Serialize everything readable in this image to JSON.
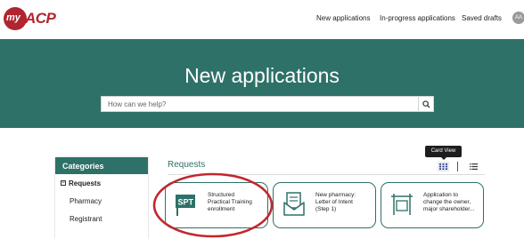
{
  "logo": {
    "prefix": "my",
    "suffix": "ACP",
    "brand_color": "#b0252f"
  },
  "nav": {
    "new_applications": "New applications",
    "in_progress": "In-progress applications",
    "saved_drafts": "Saved drafts",
    "avatar_initials": "AA"
  },
  "hero": {
    "title": "New applications",
    "search_placeholder": "How can we help?",
    "background": "#2e7168"
  },
  "categories": {
    "header": "Categories",
    "items": [
      {
        "label": "Requests",
        "expanded": true
      },
      {
        "label": "Pharmacy"
      },
      {
        "label": "Registrant"
      }
    ]
  },
  "requests": {
    "title": "Requests",
    "view_tooltip": "Card View",
    "cards": [
      {
        "line1": "Structured",
        "line2": "Practical Training",
        "line3": "enrollment",
        "icon": "spt-flag-icon"
      },
      {
        "line1": "New pharmacy:",
        "line2": "Letter of Intent",
        "line3": "(Step 1)",
        "icon": "envelope-document-icon"
      },
      {
        "line1": "Application to",
        "line2": "change the owner,",
        "line3": "major shareholder...",
        "icon": "door-frame-icon"
      }
    ]
  },
  "annotation": {
    "color": "#c1272d",
    "shape": "circle-highlight"
  }
}
